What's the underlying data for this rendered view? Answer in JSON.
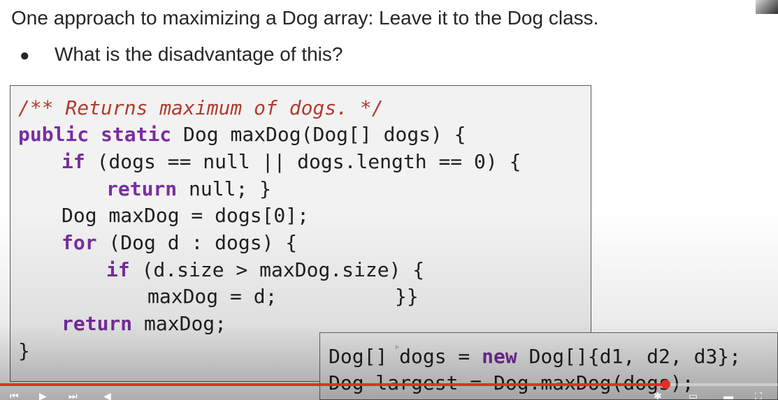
{
  "slide": {
    "title": "One approach to maximizing a Dog array: Leave it to the Dog class.",
    "bullet": "What is the disadvantage of this?"
  },
  "code": {
    "comment": "/** Returns maximum of dogs. */",
    "line2_kw1": "public",
    "line2_kw2": "static",
    "line2_rest": " Dog maxDog(Dog[] dogs) {",
    "line3_kw": "if",
    "line3_rest": " (dogs == null || dogs.length == 0) {",
    "line4_kw": "return",
    "line4_rest": " null; }",
    "line5": "Dog maxDog = dogs[0];",
    "line6_kw": "for",
    "line6_rest": " (Dog d : dogs) {",
    "line7_kw": "if",
    "line7_rest": " (d.size > maxDog.size) {",
    "line8": "maxDog = d;          }}",
    "line9_kw": "return",
    "line9_rest": " maxDog;",
    "line10": "}"
  },
  "snippet": {
    "line1_pre": "Dog[] dogs = ",
    "line1_kw": "new",
    "line1_post": " Dog[]{d1, d2, d3};",
    "line2": "Dog largest = Dog.maxDog(dogs);"
  },
  "player": {
    "progress_fraction": 0.855,
    "played_color": "#e52d27",
    "icons": [
      "skip-previous-icon",
      "play-icon",
      "skip-next-icon",
      "volume-icon",
      "settings-icon",
      "miniplayer-icon",
      "theater-icon",
      "fullscreen-icon"
    ]
  },
  "colors": {
    "keyword": "#7a2ea0",
    "comment": "#b03c2e",
    "text": "#202020",
    "code_background": "#f2f2f2"
  }
}
